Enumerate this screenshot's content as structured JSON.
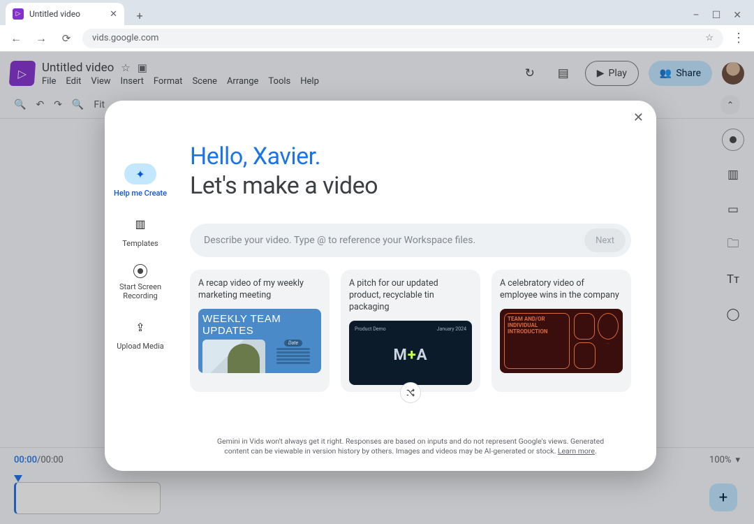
{
  "browser": {
    "tab_title": "Untitled video",
    "new_tab": "+",
    "close_tab": "✕",
    "win_min": "–",
    "win_max": "☐",
    "win_close": "✕",
    "nav_back": "←",
    "nav_fwd": "→",
    "reload": "⟳",
    "url": "vids.google.com",
    "star": "☆",
    "menu": "⋮"
  },
  "header": {
    "doc_title": "Untitled video",
    "star": "☆",
    "move": "▣",
    "menus": [
      "File",
      "Edit",
      "View",
      "Insert",
      "Format",
      "Scene",
      "Arrange",
      "Tools",
      "Help"
    ],
    "history_icon": "↻",
    "comment_icon": "▤",
    "play_icon": "▶",
    "play_label": "Play",
    "share_icon": "👥",
    "share_label": "Share"
  },
  "toolbar": {
    "search": "🔍",
    "undo": "↶",
    "redo": "↷",
    "zoom": "🔍",
    "fit_label": "Fit",
    "collapse": "⌃"
  },
  "rightrail": {
    "tt": "Tᴛ"
  },
  "timeline": {
    "current": "00:00",
    "sep": " / ",
    "total": "00:00",
    "zoom_value": "100%",
    "zoom_caret": "▾",
    "add": "+"
  },
  "modal": {
    "close": "✕",
    "left": [
      {
        "icon": "✦",
        "label": "Help me Create"
      },
      {
        "icon": "▥",
        "label": "Templates"
      },
      {
        "icon": "rec",
        "label": "Start Screen Recording"
      },
      {
        "icon": "⇪",
        "label": "Upload Media"
      }
    ],
    "greet1": "Hello, Xavier.",
    "greet2": "Let's make a video",
    "placeholder": "Describe your video. Type @ to reference your Workspace files.",
    "next": "Next",
    "cards": [
      {
        "text": "A recap video of my weekly marketing meeting",
        "thumb_banner": "WEEKLY TEAM UPDATES",
        "thumb_pill": "Date"
      },
      {
        "text": "A pitch for our updated product, recyclable tin packaging",
        "thumb_left": "Product Demo",
        "thumb_right": "January 2024",
        "thumb_logo_a": "M",
        "thumb_logo_plus": "+",
        "thumb_logo_b": "A"
      },
      {
        "text": "A celebratory video of employee wins in the company",
        "thumb_text": "TEAM AND/OR INDIVIDUAL INTRODUCTION"
      }
    ],
    "shuffle": "✕",
    "disclaimer_a": "Gemini in Vids won't always get it right. Responses are based on inputs and do not represent Google's views. Generated content can be viewable in version history by others. Images and videos may be AI-generated or stock. ",
    "disclaimer_learn": "Learn more"
  }
}
